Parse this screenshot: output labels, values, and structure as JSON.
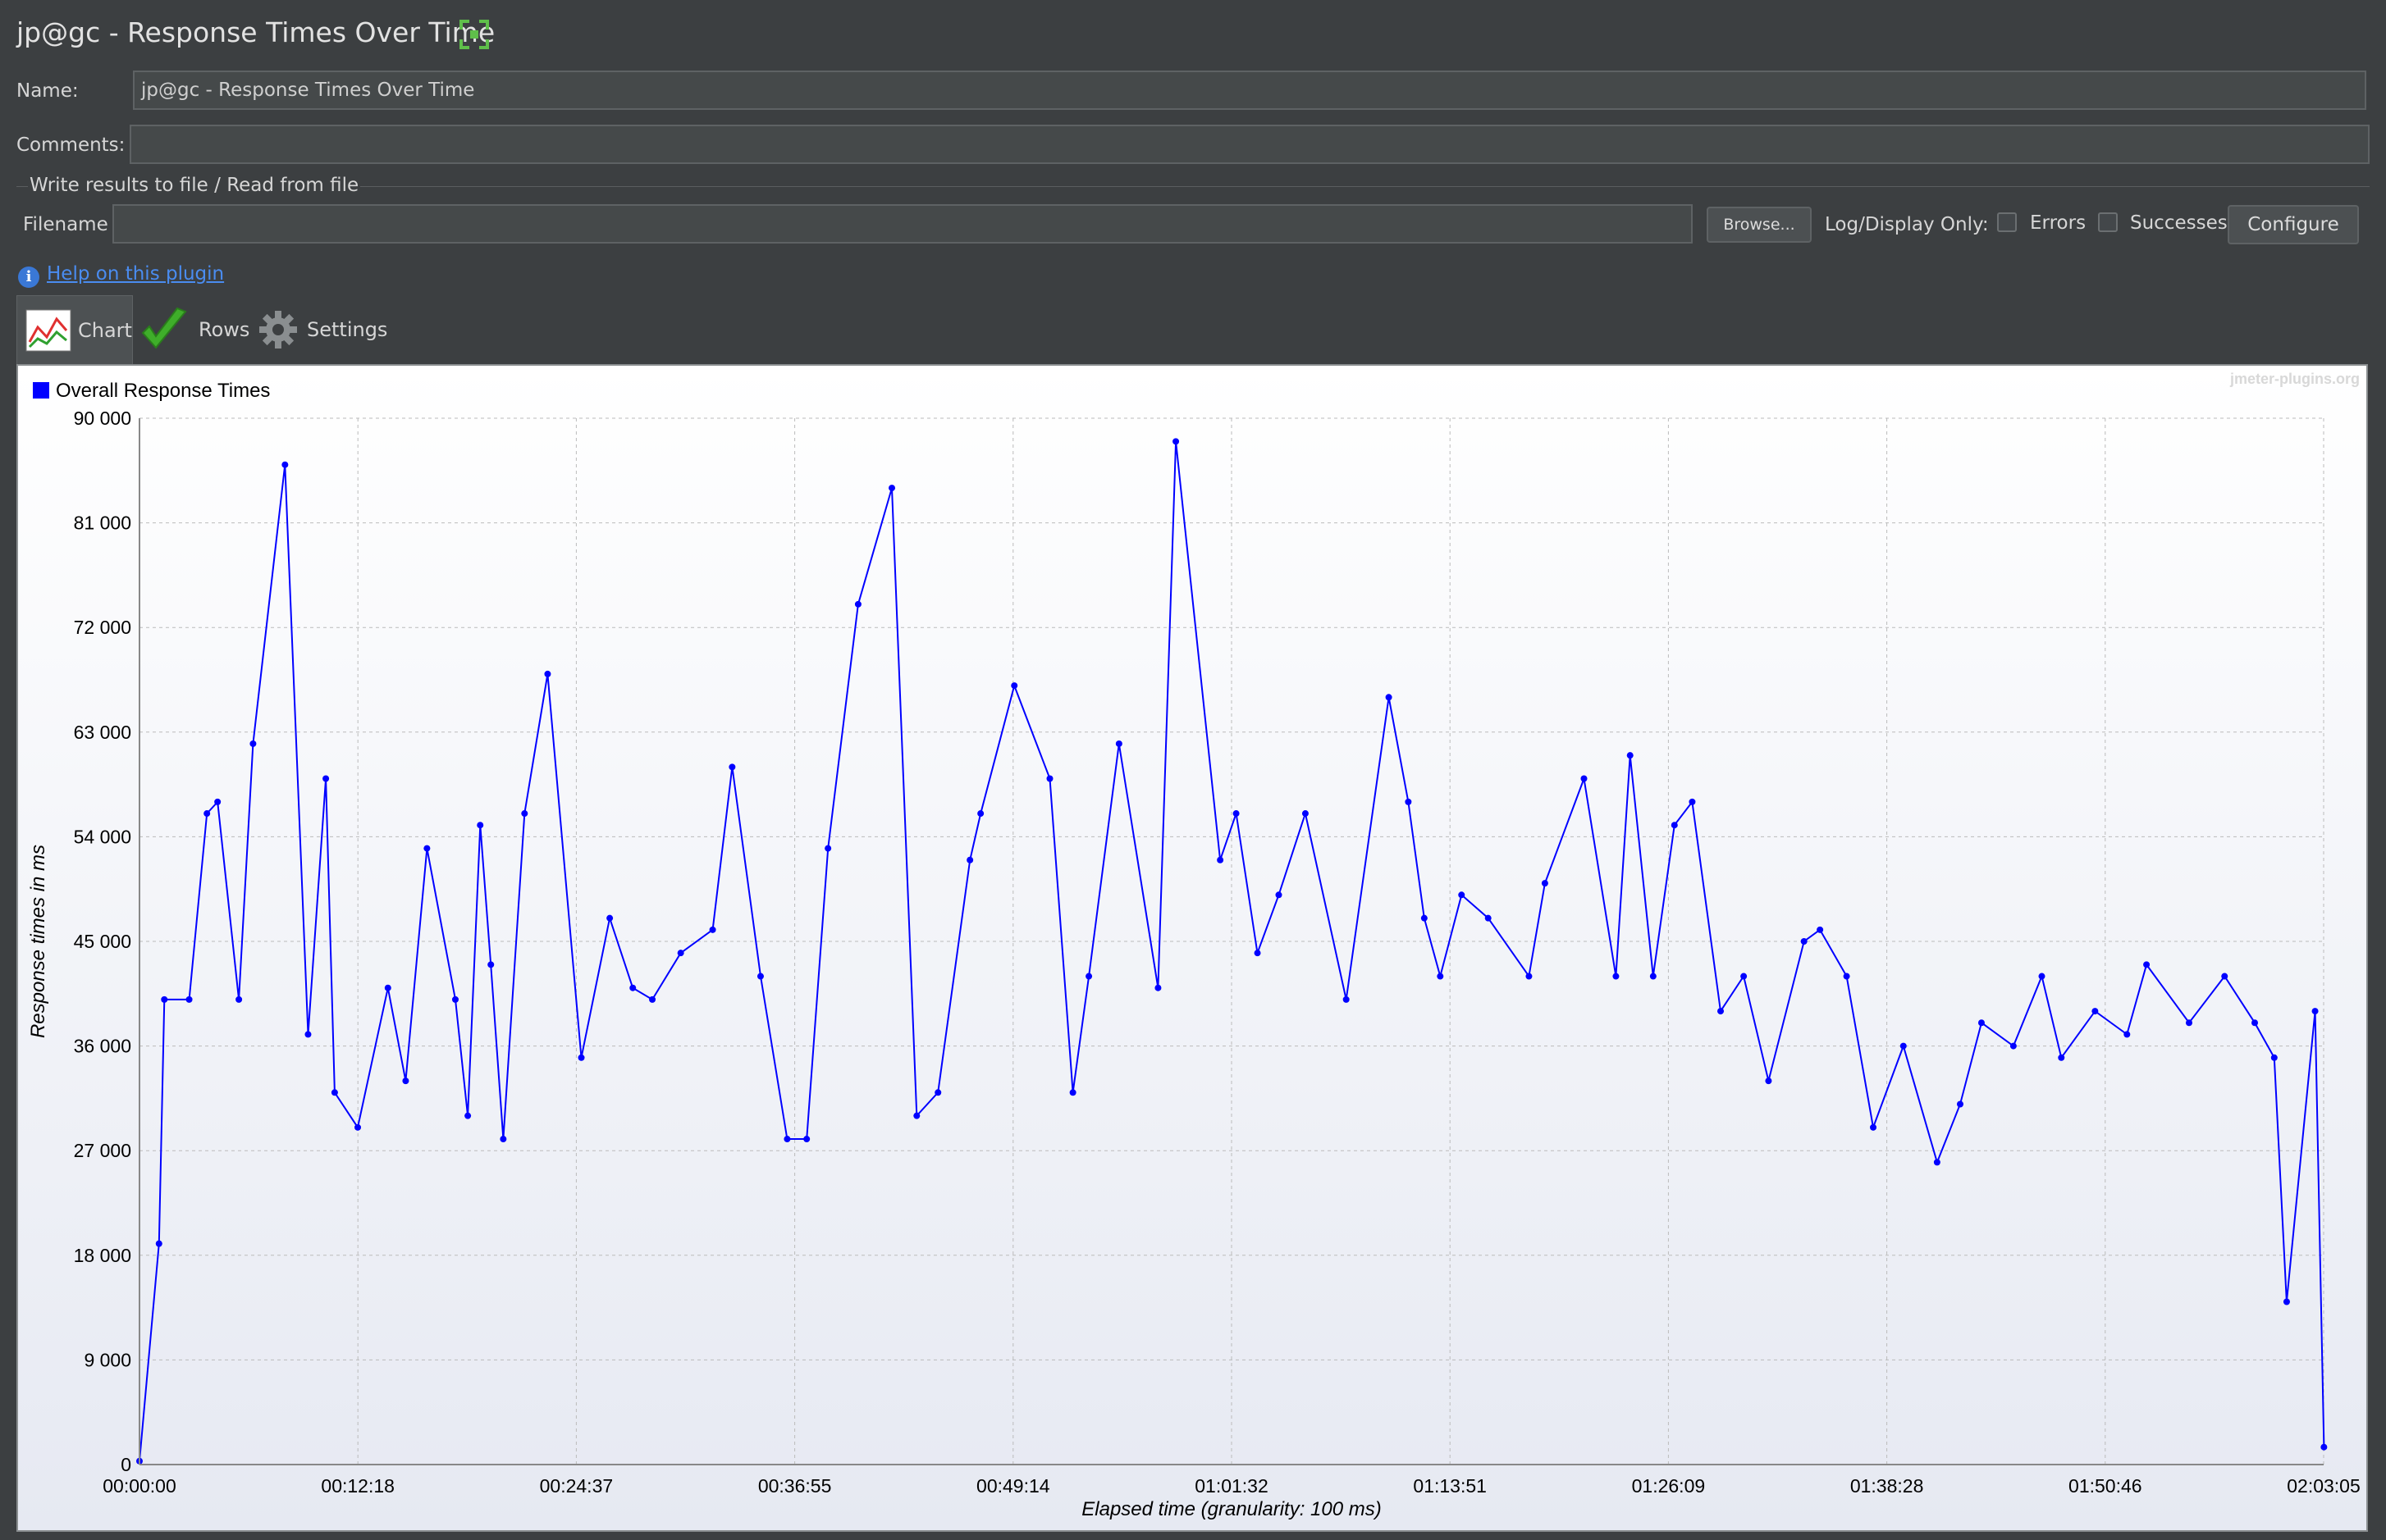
{
  "window": {
    "title": "jp@gc - Response Times Over Time"
  },
  "form": {
    "name_label": "Name:",
    "name_value": "jp@gc - Response Times Over Time",
    "comments_label": "Comments:",
    "comments_value": "",
    "file_section_title": "Write results to file / Read from file",
    "filename_label": "Filename",
    "filename_value": "",
    "browse_label": "Browse...",
    "log_display_label": "Log/Display Only:",
    "errors_label": "Errors",
    "successes_label": "Successes",
    "configure_label": "Configure"
  },
  "help": {
    "link_text": "Help on this plugin"
  },
  "tabs": [
    {
      "label": "Chart",
      "icon": "chart-icon",
      "active": true
    },
    {
      "label": "Rows",
      "icon": "checkmark-icon",
      "active": false
    },
    {
      "label": "Settings",
      "icon": "gear-icon",
      "active": false
    }
  ],
  "colors": {
    "series": "#0000ff",
    "background": "#3c3f41",
    "link": "#4a8cf0"
  },
  "chart": {
    "watermark": "jmeter-plugins.org"
  },
  "chart_data": {
    "type": "line",
    "title": "",
    "legend": [
      "Overall Response Times"
    ],
    "legend_position": "top-left",
    "xlabel": "Elapsed time (granularity: 100 ms)",
    "ylabel": "Response times in ms",
    "ylim": [
      0,
      90000
    ],
    "y_ticks": [
      "0",
      "9 000",
      "18 000",
      "27 000",
      "36 000",
      "45 000",
      "54 000",
      "63 000",
      "72 000",
      "81 000",
      "90 000"
    ],
    "x_ticks": [
      "00:00:00",
      "00:12:18",
      "00:24:37",
      "00:36:55",
      "00:49:14",
      "01:01:32",
      "01:13:51",
      "01:26:09",
      "01:38:28",
      "01:50:46",
      "02:03:05"
    ],
    "grid": true,
    "series": [
      {
        "name": "Overall Response Times",
        "color": "#0000ff",
        "x_minutes": [
          0.0,
          1.1,
          1.4,
          2.8,
          3.8,
          4.4,
          5.6,
          6.4,
          8.2,
          9.5,
          10.5,
          11.0,
          12.3,
          14.0,
          15.0,
          16.2,
          17.8,
          18.5,
          19.2,
          19.8,
          20.5,
          21.7,
          23.0,
          24.9,
          26.5,
          27.8,
          28.9,
          30.5,
          32.3,
          33.4,
          35.0,
          36.5,
          37.6,
          38.8,
          40.5,
          42.4,
          43.8,
          45.0,
          46.8,
          47.4,
          49.3,
          51.3,
          52.6,
          53.5,
          55.2,
          57.4,
          58.4,
          60.9,
          61.8,
          63.0,
          64.2,
          65.7,
          68.0,
          70.4,
          71.5,
          72.4,
          73.3,
          74.5,
          76.0,
          78.3,
          79.2,
          81.4,
          83.2,
          84.0,
          85.3,
          86.5,
          87.5,
          89.1,
          90.4,
          91.8,
          93.8,
          94.7,
          96.2,
          97.7,
          99.4,
          101.3,
          102.6,
          103.8,
          105.6,
          107.2,
          108.3,
          110.2,
          112.0,
          113.1,
          115.5,
          117.5,
          119.2,
          120.3,
          121.0,
          122.6,
          123.1
        ],
        "values": [
          300,
          19000,
          40000,
          40000,
          56000,
          57000,
          40000,
          62000,
          86000,
          37000,
          59000,
          32000,
          29000,
          41000,
          33000,
          53000,
          40000,
          30000,
          55000,
          43000,
          28000,
          56000,
          68000,
          35000,
          47000,
          41000,
          40000,
          44000,
          46000,
          60000,
          42000,
          28000,
          28000,
          53000,
          74000,
          84000,
          30000,
          32000,
          52000,
          56000,
          67000,
          59000,
          32000,
          42000,
          62000,
          41000,
          88000,
          52000,
          56000,
          44000,
          49000,
          56000,
          40000,
          66000,
          57000,
          47000,
          42000,
          49000,
          47000,
          42000,
          50000,
          59000,
          42000,
          61000,
          42000,
          55000,
          57000,
          39000,
          42000,
          33000,
          45000,
          46000,
          42000,
          29000,
          36000,
          26000,
          31000,
          38000,
          36000,
          42000,
          35000,
          39000,
          37000,
          43000,
          38000,
          42000,
          38000,
          35000,
          14000,
          39000,
          1500
        ]
      }
    ]
  }
}
